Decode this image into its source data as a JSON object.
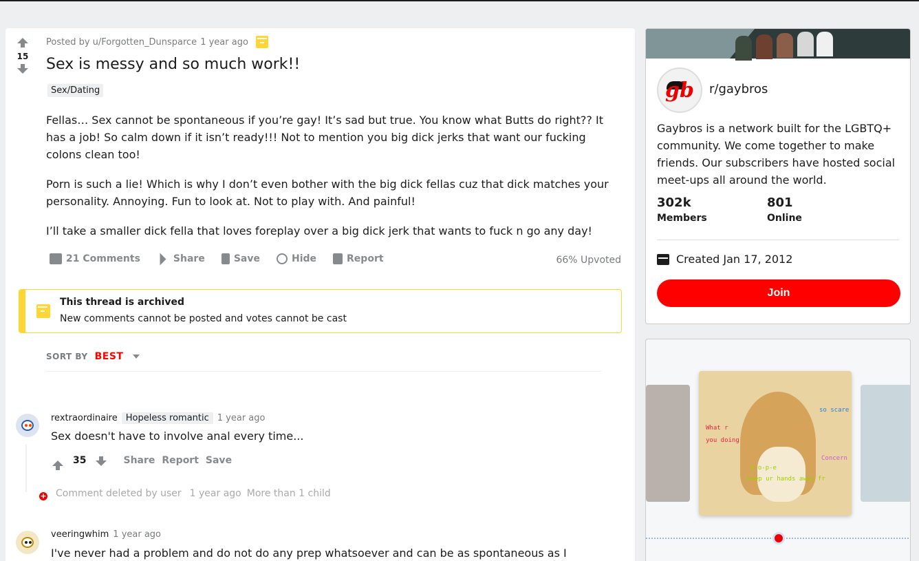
{
  "post": {
    "score": "15",
    "posted_by": "Posted by u/Forgotten_Dunsparce",
    "time": "1 year ago",
    "title": "Sex is messy and so much work!!",
    "flair": "Sex/Dating",
    "paragraphs": [
      "Fellas… Sex cannot be spontaneous if you’re gay! It’s sad but true. You know what Butts do right?? It has a job! So calm down if it isn’t ready!!! Not to mention you big dick jerks that want our fucking colons clean too!",
      "Porn is such a lie! Which is why I don’t even bother with the big dick fellas cuz that dick matches your personality. Annoying. Fun to look at. Not to play with. And painful!",
      "I’ll take a smaller dick fella that loves foreplay over a big dick jerk that wants to fuck n go any day!"
    ],
    "actions": {
      "comments": "21 Comments",
      "share": "Share",
      "save": "Save",
      "hide": "Hide",
      "report": "Report"
    },
    "upvoted": "66% Upvoted"
  },
  "archived": {
    "title": "This thread is archived",
    "text": "New comments cannot be posted and votes cannot be cast"
  },
  "sort": {
    "label": "SORT BY",
    "value": "BEST"
  },
  "comments": [
    {
      "user": "rextraordinaire",
      "flair": "Hopeless romantic",
      "time": "1 year ago",
      "text": "Sex doesn't have to involve anal every time...",
      "score": "35",
      "share": "Share",
      "report": "Report",
      "save": "Save"
    },
    {
      "user": "veeringwhim",
      "time": "1 year ago",
      "text": "I've never had a problem and do not do any prep whatsoever and can be as spontaneous as I"
    }
  ],
  "deleted": {
    "text": "Comment deleted by user",
    "time": "1 year ago",
    "more": "More than 1 child"
  },
  "sidebar": {
    "name": "r/gaybros",
    "logo_text": "gb",
    "description": "Gaybros is a network built for the LGBTQ+ community. We come together to make friends. Our subscribers have hosted social meet-ups all around the world.",
    "members_count": "302k",
    "members_label": "Members",
    "online_count": "801",
    "online_label": "Online",
    "created": "Created Jan 17, 2012",
    "join": "Join"
  },
  "promo": {
    "texts": [
      "What r",
      "you doing",
      "so scare",
      "Concern",
      "d-o-p-e",
      "keep ur hands away fr"
    ]
  },
  "colors": {
    "accent": "#ff0000",
    "archive": "#ffd635",
    "muted": "#878a8c"
  }
}
